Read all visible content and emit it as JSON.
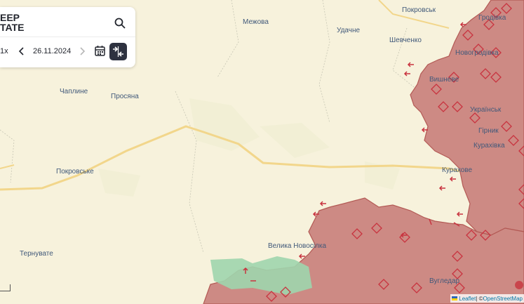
{
  "brand": {
    "line1": "EEP",
    "line2": "TATE"
  },
  "timeline": {
    "speed": "1x",
    "date": "26.11.2024",
    "prev_icon": "chevron-left-icon",
    "next_icon": "chevron-right-icon"
  },
  "map": {
    "labels": [
      "Межова",
      "Покровськ",
      "Удачне",
      "Шевченко",
      "Гродівка",
      "Чаплине",
      "Просяна",
      "Новогродівка",
      "Вишневе",
      "Українськ",
      "Гірник",
      "Курахівка",
      "Покровське",
      "Курахове",
      "Велика Новосілка",
      "Тернувате",
      "Вугледар"
    ],
    "colors": {
      "background": "#f7f2dc",
      "occupied": "#cd8a84",
      "occupied_border": "#b35a55",
      "liberated": "#9fd5ad",
      "road": "#f5d98e",
      "label": "#41597a",
      "marker": "#c8333f"
    }
  },
  "attribution": {
    "leaflet": "Leaflet",
    "separator": " | © ",
    "osm": "OpenStreetMap"
  },
  "scale_bar": {
    "label": ""
  }
}
